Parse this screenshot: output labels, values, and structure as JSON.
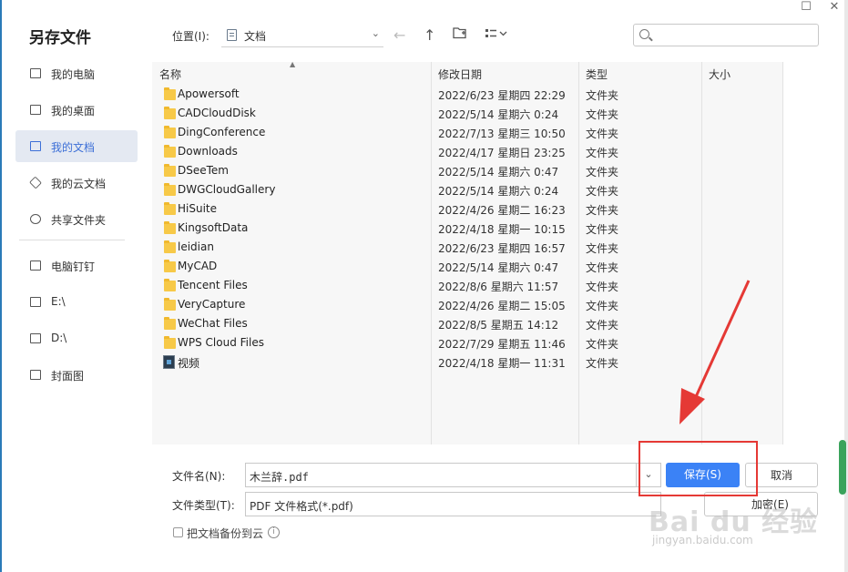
{
  "dialog": {
    "title": "另存文件",
    "controls": {
      "maximize": "☐",
      "close": "✕"
    }
  },
  "location": {
    "label": "位置(I):",
    "value": "文档"
  },
  "search": {
    "placeholder": ""
  },
  "sidebar": {
    "items": [
      {
        "label": "我的电脑",
        "icon": "computer-icon"
      },
      {
        "label": "我的桌面",
        "icon": "desktop-icon"
      },
      {
        "label": "我的文档",
        "icon": "documents-icon",
        "active": true
      },
      {
        "label": "我的云文档",
        "icon": "cloud-docs-icon"
      },
      {
        "label": "共享文件夹",
        "icon": "share-icon"
      }
    ],
    "items2": [
      {
        "label": "电脑钉钉",
        "icon": "folder-icon"
      },
      {
        "label": "E:\\",
        "icon": "folder-icon"
      },
      {
        "label": "D:\\",
        "icon": "folder-icon"
      },
      {
        "label": "封面图",
        "icon": "folder-icon"
      }
    ]
  },
  "table": {
    "headers": {
      "name": "名称",
      "date": "修改日期",
      "type": "类型",
      "size": "大小"
    },
    "rows": [
      {
        "name": "Apowersoft",
        "date": "2022/6/23 星期四 22:29",
        "type": "文件夹",
        "kind": "folder"
      },
      {
        "name": "CADCloudDisk",
        "date": "2022/5/14 星期六 0:24",
        "type": "文件夹",
        "kind": "folder"
      },
      {
        "name": "DingConference",
        "date": "2022/7/13 星期三 10:50",
        "type": "文件夹",
        "kind": "folder"
      },
      {
        "name": "Downloads",
        "date": "2022/4/17 星期日 23:25",
        "type": "文件夹",
        "kind": "folder"
      },
      {
        "name": "DSeeTem",
        "date": "2022/5/14 星期六 0:47",
        "type": "文件夹",
        "kind": "folder"
      },
      {
        "name": "DWGCloudGallery",
        "date": "2022/5/14 星期六 0:24",
        "type": "文件夹",
        "kind": "folder"
      },
      {
        "name": "HiSuite",
        "date": "2022/4/26 星期二 16:23",
        "type": "文件夹",
        "kind": "folder"
      },
      {
        "name": "KingsoftData",
        "date": "2022/4/18 星期一 10:15",
        "type": "文件夹",
        "kind": "folder"
      },
      {
        "name": "leidian",
        "date": "2022/6/23 星期四 16:57",
        "type": "文件夹",
        "kind": "folder"
      },
      {
        "name": "MyCAD",
        "date": "2022/5/14 星期六 0:47",
        "type": "文件夹",
        "kind": "folder"
      },
      {
        "name": "Tencent Files",
        "date": "2022/8/6 星期六 11:57",
        "type": "文件夹",
        "kind": "folder"
      },
      {
        "name": "VeryCapture",
        "date": "2022/4/26 星期二 15:05",
        "type": "文件夹",
        "kind": "folder"
      },
      {
        "name": "WeChat Files",
        "date": "2022/8/5 星期五 14:12",
        "type": "文件夹",
        "kind": "folder"
      },
      {
        "name": "WPS Cloud Files",
        "date": "2022/7/29 星期五 11:46",
        "type": "文件夹",
        "kind": "folder"
      },
      {
        "name": "视频",
        "date": "2022/4/18 星期一 11:31",
        "type": "文件夹",
        "kind": "video"
      }
    ]
  },
  "form": {
    "filename_label": "文件名(N):",
    "filename_value": "木兰辞.pdf",
    "filetype_label": "文件类型(T):",
    "filetype_value": "PDF 文件格式(*.pdf)",
    "save_label": "保存(S)",
    "cancel_label": "取消",
    "encrypt_label": "加密(E)",
    "backup_label": "把文档备份到云"
  },
  "watermark": {
    "main": "Bai du 经验",
    "sub": "jingyan.baidu.com"
  },
  "colors": {
    "accent": "#3b82f6",
    "annotation": "#e53935",
    "folder": "#f7c948"
  }
}
